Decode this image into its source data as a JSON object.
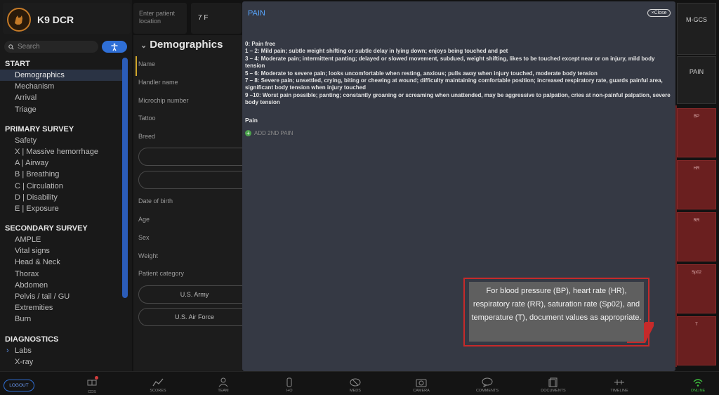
{
  "app": {
    "title": "K9 DCR"
  },
  "search": {
    "placeholder": "Search"
  },
  "patient_location": {
    "label_line1": "Enter patient",
    "label_line2": "location"
  },
  "ward": {
    "value": "7 F"
  },
  "nav": {
    "sections": [
      {
        "title": "START",
        "items": [
          "Demographics",
          "Mechanism",
          "Arrival",
          "Triage"
        ]
      },
      {
        "title": "PRIMARY SURVEY",
        "items": [
          "Safety",
          "X | Massive hemorrhage",
          "A | Airway",
          "B | Breathing",
          "C | Circulation",
          "D | Disability",
          "E | Exposure"
        ]
      },
      {
        "title": "SECONDARY SURVEY",
        "items": [
          "AMPLE",
          "Vital signs",
          "Head & Neck",
          "Thorax",
          "Abdomen",
          "Pelvis / tail / GU",
          "Extremities",
          "Burn"
        ]
      },
      {
        "title": "DIAGNOSTICS",
        "items": [
          "Labs",
          "X-ray"
        ]
      }
    ],
    "active": "Demographics"
  },
  "demographics": {
    "title": "Demographics",
    "labels": {
      "name": "Name",
      "handler": "Handler name",
      "microchip": "Microchip number",
      "tattoo": "Tattoo",
      "breed": "Breed",
      "dob": "Date of birth",
      "age": "Age",
      "sex": "Sex",
      "weight": "Weight",
      "category": "Patient category"
    },
    "category_options": [
      "U.S. Army",
      "U.S. Air Force"
    ]
  },
  "modal": {
    "title": "PAIN",
    "close_label": "Close",
    "scale_lines": [
      "0: Pain free",
      "1 – 2: Mild pain; subtle weight shifting or subtle delay in lying down; enjoys being touched and pet",
      "3 – 4: Moderate pain; intermittent panting; delayed or slowed movement, subdued, weight shifting, likes to be touched except near or on injury, mild body tension",
      "5 – 6: Moderate to severe pain; looks uncomfortable when resting, anxious; pulls away when injury touched, moderate body tension",
      "7 – 8: Severe pain; unsettled, crying, biting or chewing at wound; difficulty maintaining comfortable position; increased respiratory rate, guards painful area, significant body tension when injury touched",
      "9 –10: Worst pain possible; panting; constantly groaning or screaming when unattended, may be aggressive to palpation, cries at non-painful palpation, severe body tension"
    ],
    "pain_label": "Pain",
    "add_second": "ADD 2ND PAIN"
  },
  "right_panel": {
    "mgcs": "M-GCS",
    "pain": "PAIN",
    "vitals": [
      "BP",
      "HR",
      "RR",
      "Sp02",
      "T"
    ]
  },
  "tooltip": {
    "text": "For blood pressure (BP), heart rate (HR), respiratory rate (RR), saturation rate (Sp02), and temperature (T), document values as appropriate."
  },
  "toolbar": {
    "logout": "LOGOUT",
    "items": [
      "CDS",
      "SCORES",
      "TEAM",
      "I+O",
      "MEDS",
      "CAMERA",
      "COMMENTS",
      "DOCUMENTS",
      "TIMELINE",
      "ONLINE"
    ]
  },
  "colors": {
    "accent": "#2f6fd6",
    "modal_title": "#58a6ff",
    "tooltip_border": "#c62a2a",
    "online": "#3fbf3f",
    "logo_ring": "#c47a28"
  }
}
